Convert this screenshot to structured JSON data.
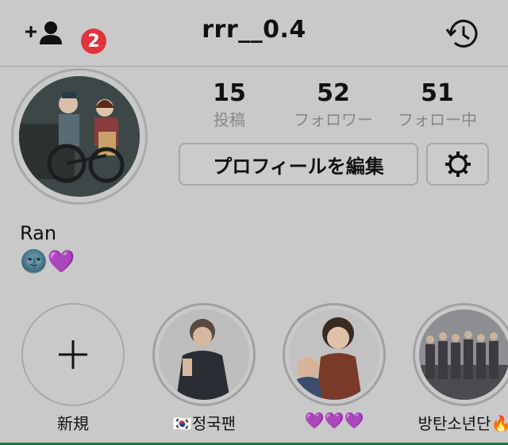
{
  "header": {
    "username": "rrr__0.4",
    "notification_count": "2"
  },
  "stats": [
    {
      "count": "15",
      "label": "投稿"
    },
    {
      "count": "52",
      "label": "フォロワー"
    },
    {
      "count": "51",
      "label": "フォロー中"
    }
  ],
  "actions": {
    "edit_profile_label": "プロフィールを編集"
  },
  "profile": {
    "display_name": "Ran",
    "bio": "🌚💜"
  },
  "highlights": [
    {
      "label": "新規"
    },
    {
      "label": "🇰🇷정국팬"
    },
    {
      "label": "💜💜💜"
    },
    {
      "label": "방탄소년단🔥"
    }
  ],
  "colors": {
    "background": "#c9c9c9",
    "badge": "#e0343f"
  },
  "icons": {
    "add_friend": "add-friend-icon",
    "history": "history-icon",
    "settings": "gear-icon",
    "new_highlight": "plus-icon"
  }
}
